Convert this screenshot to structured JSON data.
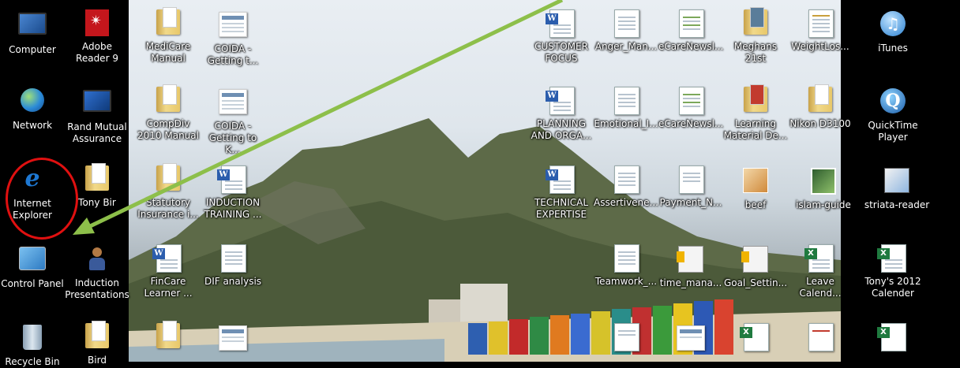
{
  "desktop": {
    "left_column": [
      {
        "label": "Computer",
        "icon": "computer-icon"
      },
      {
        "label": "Network",
        "icon": "network-icon"
      },
      {
        "label": "Internet\nExplorer",
        "icon": "internet-explorer-icon"
      },
      {
        "label": "Control Panel",
        "icon": "control-panel-icon"
      },
      {
        "label": "Recycle Bin",
        "icon": "recycle-bin-icon"
      }
    ],
    "column2": [
      {
        "label": "Adobe\nReader 9",
        "icon": "adobe-reader-icon"
      },
      {
        "label": "Rand Mutual\nAssurance",
        "icon": "monitor-icon"
      },
      {
        "label": "Tony Bir",
        "icon": "user-folder-icon"
      },
      {
        "label": "Induction\nPresentations",
        "icon": "people-icon"
      },
      {
        "label": "Bird",
        "icon": "folder-icon"
      }
    ],
    "column3": [
      {
        "label": "MediCare\nManual",
        "icon": "folder-icon"
      },
      {
        "label": "CompDiv\n2010 Manual",
        "icon": "folder-icon"
      },
      {
        "label": "Statutory\nInsurance i...",
        "icon": "folder-icon"
      },
      {
        "label": "FinCare\nLearner ...",
        "icon": "word-doc-icon"
      },
      {
        "label": "",
        "icon": "folder-icon"
      }
    ],
    "column4": [
      {
        "label": "COIDA -\nGetting t...",
        "icon": "document-icon"
      },
      {
        "label": "COIDA -\nGetting to K...",
        "icon": "document-icon"
      },
      {
        "label": "INDUCTION\nTRAINING ...",
        "icon": "word-doc-icon"
      },
      {
        "label": "DIF analysis",
        "icon": "document-icon"
      },
      {
        "label": "",
        "icon": "document-icon"
      }
    ],
    "right_grid": [
      {
        "label": "CUSTOMER\nFOCUS",
        "icon": "word-doc-icon"
      },
      {
        "label": "Anger_Man...",
        "icon": "document-icon"
      },
      {
        "label": "eCareNewsl...",
        "icon": "document-icon"
      },
      {
        "label": "Meghans\n21st",
        "icon": "folder-icon"
      },
      {
        "label": "WeightLos...",
        "icon": "spreadsheet-icon"
      },
      {
        "label": "iTunes",
        "icon": "itunes-icon"
      },
      {
        "label": "PLANNING\nAND ORGA...",
        "icon": "word-doc-icon"
      },
      {
        "label": "Emotional_I...",
        "icon": "document-icon"
      },
      {
        "label": "eCareNewsl...",
        "icon": "document-icon"
      },
      {
        "label": "Learning\nMaterial De...",
        "icon": "folder-icon"
      },
      {
        "label": "Nikon D3100",
        "icon": "folder-icon"
      },
      {
        "label": "QuickTime\nPlayer",
        "icon": "quicktime-icon"
      },
      {
        "label": "TECHNICAL\nEXPERTISE",
        "icon": "word-doc-icon"
      },
      {
        "label": "Assertivene...",
        "icon": "document-icon"
      },
      {
        "label": "Payment_N...",
        "icon": "document-icon"
      },
      {
        "label": "beef",
        "icon": "image-icon"
      },
      {
        "label": "islam-guide",
        "icon": "photo-icon"
      },
      {
        "label": "striata-reader",
        "icon": "installer-icon"
      },
      {
        "label": "",
        "icon": "none"
      },
      {
        "label": "Teamwork_...",
        "icon": "document-icon"
      },
      {
        "label": "time_mana...",
        "icon": "script-icon"
      },
      {
        "label": "Goal_Settin...",
        "icon": "script-icon"
      },
      {
        "label": "Leave\nCalend...",
        "icon": "excel-icon"
      },
      {
        "label": "Tony's 2012\nCalender",
        "icon": "excel-icon"
      }
    ]
  },
  "annotation": {
    "highlight_color": "#e01010",
    "arrow_color": "#8dbf4a"
  }
}
